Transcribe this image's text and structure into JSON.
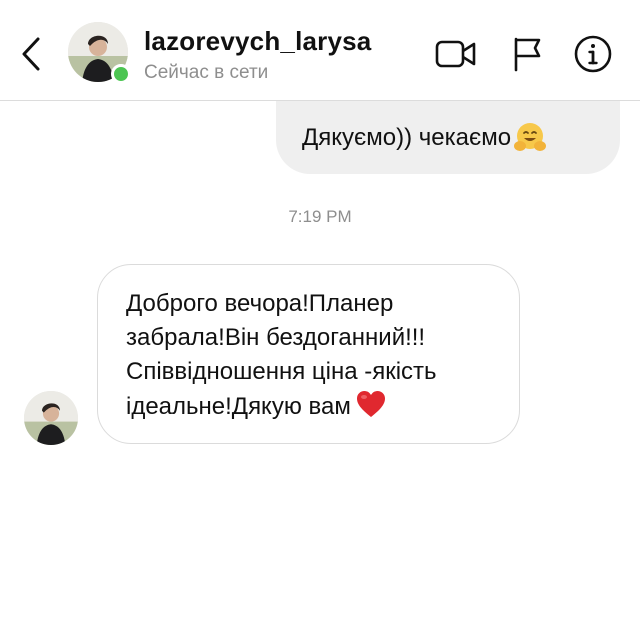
{
  "header": {
    "username": "lazorevych_larysa",
    "status": "Сейчас в сети",
    "online_color": "#4cc552",
    "icons": [
      "chevron-left-icon",
      "video-camera-icon",
      "flag-icon",
      "info-icon"
    ]
  },
  "conversation": {
    "outgoing_message": "Дякуємо)) чекаємо",
    "outgoing_emoji": "hugging-face",
    "timestamp": "7:19 PM",
    "incoming_message_lines": [
      "Доброго вечора!Планер",
      "забрала!Він бездоганний!!!",
      "Співвідношення ціна -якість",
      "ідеальне!Дякую вам"
    ],
    "incoming_emoji": "red-heart"
  }
}
